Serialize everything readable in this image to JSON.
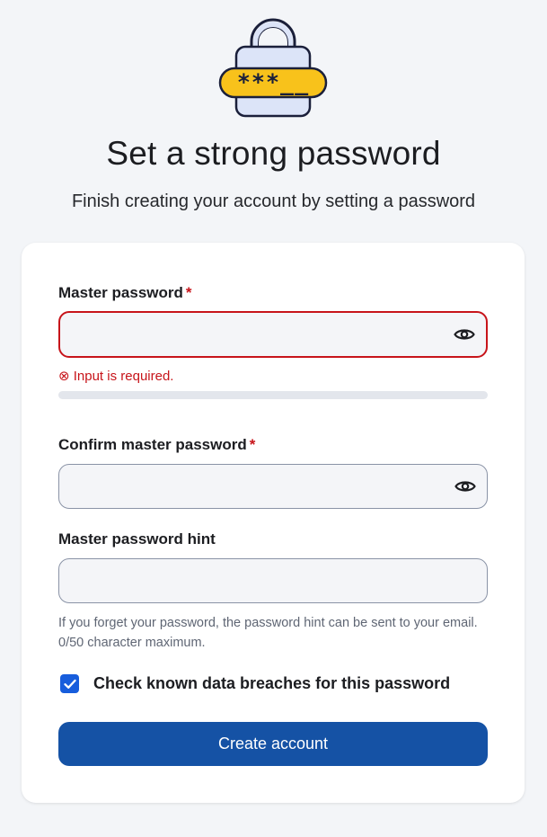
{
  "header": {
    "title": "Set a strong password",
    "subtitle": "Finish creating your account by setting a password",
    "illustration_text": "***__"
  },
  "form": {
    "master_password": {
      "label": "Master password",
      "required_mark": "*",
      "value": "",
      "error": "⊗ Input is required.",
      "toggle_icon": "eye-icon"
    },
    "confirm_password": {
      "label": "Confirm master password",
      "required_mark": "*",
      "value": "",
      "toggle_icon": "eye-icon"
    },
    "hint": {
      "label": "Master password hint",
      "value": "",
      "help_text": "If you forget your password, the password hint can be sent to your email. 0/50 character maximum."
    },
    "breach_check": {
      "label": "Check known data breaches for this password",
      "checked": true
    },
    "submit_label": "Create account"
  },
  "colors": {
    "primary": "#1552a5",
    "error": "#c7141a",
    "checkbox": "#175ddc",
    "lock_yellow": "#f8c21b",
    "lock_body": "#dce4f8",
    "outline": "#1a1f3a"
  }
}
